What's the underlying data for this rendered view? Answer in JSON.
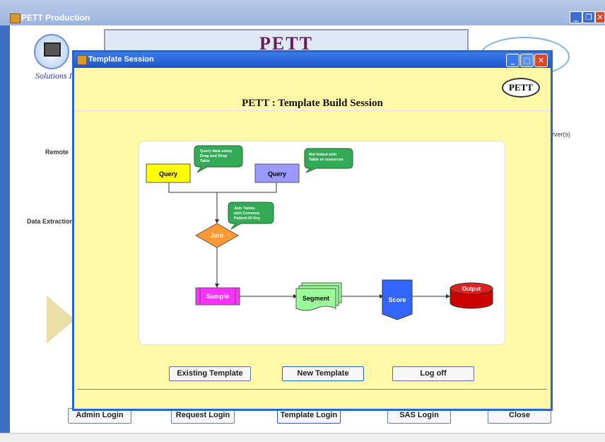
{
  "outer_window": {
    "title": "PETT Production"
  },
  "banner": {
    "title": "PETT"
  },
  "logo": {
    "text": "Solutions I"
  },
  "background_labels": {
    "remote": "Remote",
    "data_extraction": "Data Extraction",
    "server": "erver(s)"
  },
  "main_buttons": {
    "admin": "Admin Login",
    "request": "Request Login",
    "template": "Template Login",
    "sas": "SAS Login",
    "close": "Close"
  },
  "dialog": {
    "title": "Template Session",
    "heading": "PETT : Template Build Session",
    "logo": "PETT",
    "buttons": {
      "existing": "Existing Template",
      "new": "New Template",
      "logoff": "Log off"
    }
  },
  "diagram": {
    "query1": "Query",
    "query2": "Query",
    "join": "Join",
    "sample": "Sample",
    "segment": "Segment",
    "score": "Score",
    "output": "Output",
    "callout1": [
      "Query data using",
      "Drag and Drop",
      "Table"
    ],
    "callout2": [
      "Not linked with",
      "Table or resources"
    ],
    "callout3": [
      "Join Tables",
      "with Common",
      "Patient-ID Key"
    ]
  },
  "colors": {
    "dialog_bg": "#fff9a8",
    "titlebar": "#2a63d0",
    "query1": "#ffff00",
    "query2": "#9999ff",
    "join": "#ff9933",
    "sample": "#ff33ff",
    "segment": "#99ff99",
    "score": "#3366ff",
    "output": "#cc0000",
    "callout": "#33aa55"
  }
}
